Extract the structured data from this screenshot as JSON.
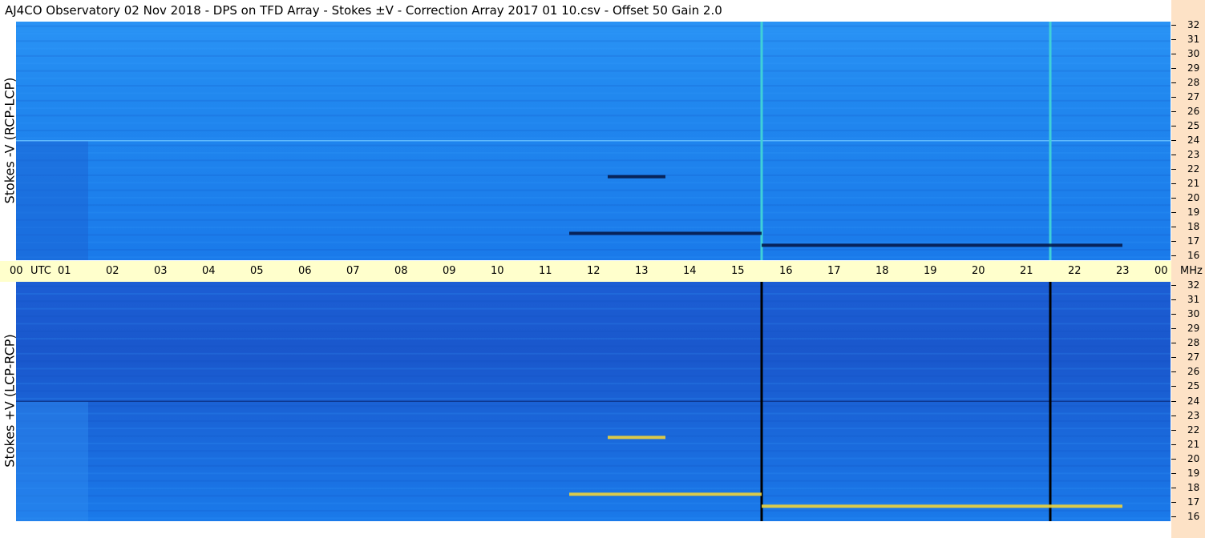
{
  "title": "AJ4CO Observatory  02 Nov 2018  -  DPS on TFD Array  -  Stokes ±V  -  Correction Array 2017 01 10.csv  -  Offset 50  Gain 2.0",
  "panels": {
    "top_label": "Stokes -V (RCP-LCP)",
    "bottom_label": "Stokes +V (LCP-RCP)"
  },
  "time_axis": {
    "ticks": [
      "00",
      "01",
      "02",
      "03",
      "04",
      "05",
      "06",
      "07",
      "08",
      "09",
      "10",
      "11",
      "12",
      "13",
      "14",
      "15",
      "16",
      "17",
      "18",
      "19",
      "20",
      "21",
      "22",
      "23",
      "00"
    ],
    "utc_label": "UTC",
    "unit_label": "MHz"
  },
  "freq_axis": {
    "ticks": [
      "32",
      "31",
      "30",
      "29",
      "28",
      "27",
      "26",
      "25",
      "24",
      "23",
      "22",
      "21",
      "20",
      "19",
      "18",
      "17",
      "16"
    ]
  },
  "colors": {
    "background": "#1f86f0",
    "dark_band": "#0a3a8e",
    "axis_band": "#ffffcc",
    "peach": "#fde2c6"
  },
  "chart_data": [
    {
      "type": "heatmap",
      "title": "Stokes -V (RCP-LCP)",
      "xlabel": "UTC",
      "ylabel": "MHz",
      "xlim": [
        0,
        24
      ],
      "ylim": [
        16,
        32
      ],
      "features": [
        {
          "time": 15.5,
          "kind": "vertical line",
          "color": "#3fd0d8"
        },
        {
          "time": 21.5,
          "kind": "vertical line",
          "color": "#3fd0d8"
        },
        {
          "time": [
            11.5,
            15.5
          ],
          "freq": 17.8,
          "kind": "dark horizontal band"
        },
        {
          "time": [
            12.3,
            13.5
          ],
          "freq": 21.6,
          "kind": "dark horizontal band"
        },
        {
          "time": [
            15.5,
            23.0
          ],
          "freq": 17.0,
          "kind": "dark horizontal band"
        }
      ]
    },
    {
      "type": "heatmap",
      "title": "Stokes +V (LCP-RCP)",
      "xlabel": "UTC",
      "ylabel": "MHz",
      "xlim": [
        0,
        24
      ],
      "ylim": [
        16,
        32
      ],
      "features": [
        {
          "time": 15.5,
          "kind": "vertical black line",
          "color": "#000000"
        },
        {
          "time": 21.5,
          "kind": "vertical black line",
          "color": "#000000"
        },
        {
          "time": [
            11.5,
            15.5
          ],
          "freq": 17.8,
          "kind": "bright horizontal band"
        },
        {
          "time": [
            12.3,
            13.5
          ],
          "freq": 21.6,
          "kind": "bright horizontal band"
        },
        {
          "time": [
            15.5,
            23.0
          ],
          "freq": 17.0,
          "kind": "bright horizontal band"
        }
      ]
    }
  ]
}
